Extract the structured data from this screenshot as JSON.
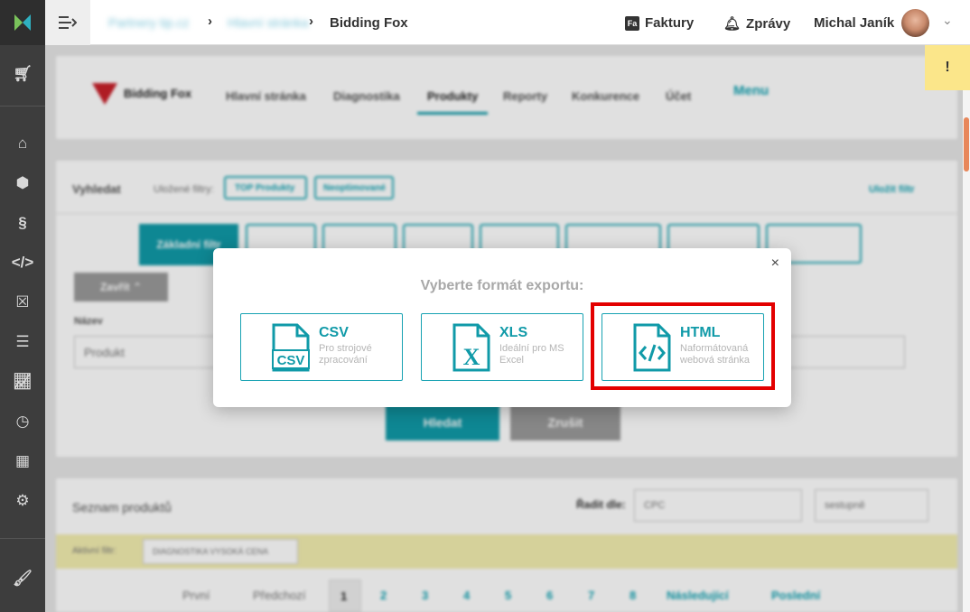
{
  "topbar": {
    "breadcrumb": [
      "Partnery tip.cz",
      "Hlavní stránka",
      "Bidding Fox"
    ],
    "faktury": "Faktury",
    "zpravy": "Zprávy",
    "user": "Michal Janík",
    "faktury_icon": "invoice-icon",
    "zpravy_icon": "bell-icon"
  },
  "warning": "!",
  "app": {
    "brand": "Bidding Fox",
    "nav": [
      "Hlavní stránka",
      "Diagnostika",
      "Produkty",
      "Reporty",
      "Konkurence",
      "Účet"
    ],
    "nav_active": "Produkty",
    "menu": "Menu",
    "search_label": "Vyhledat",
    "saved_filters": "Uložené filtry:",
    "filter_chips": [
      "TOP Produkty",
      "Neoptimované"
    ],
    "save_filter": "Uložit filtr",
    "tab_active": "Základní filtr",
    "expand_btn": "Zavřít ⌃",
    "name_label": "Název",
    "name_placeholder": "Produkt",
    "search_btn": "Hledat",
    "cancel_btn": "Zrušit",
    "list_title": "Seznam produktů",
    "sort_label": "Řadit dle:",
    "sort_value": "CPC",
    "sort_order": "sestupně",
    "active_filter_label": "Aktivní filtr:",
    "active_filter_chip": "DIAGNOSTIKA VYSOKÁ CENA",
    "pagination": [
      "První",
      "Předchozí",
      "1",
      "2",
      "3",
      "4",
      "5",
      "6",
      "7",
      "8",
      "Následující",
      "Poslední"
    ]
  },
  "modal": {
    "title": "Vyberte formát exportu:",
    "options": [
      {
        "label": "CSV",
        "desc": "Pro strojové zpracování",
        "icon": "csv-file-icon"
      },
      {
        "label": "XLS",
        "desc": "Ideální pro MS Excel",
        "icon": "xls-file-icon"
      },
      {
        "label": "HTML",
        "desc": "Naformátovaná webová stránka",
        "icon": "html-file-icon"
      }
    ],
    "close": "×"
  },
  "colors": {
    "accent": "#109aa8",
    "highlight": "#e30000",
    "sidebar": "#3d3d3d"
  }
}
